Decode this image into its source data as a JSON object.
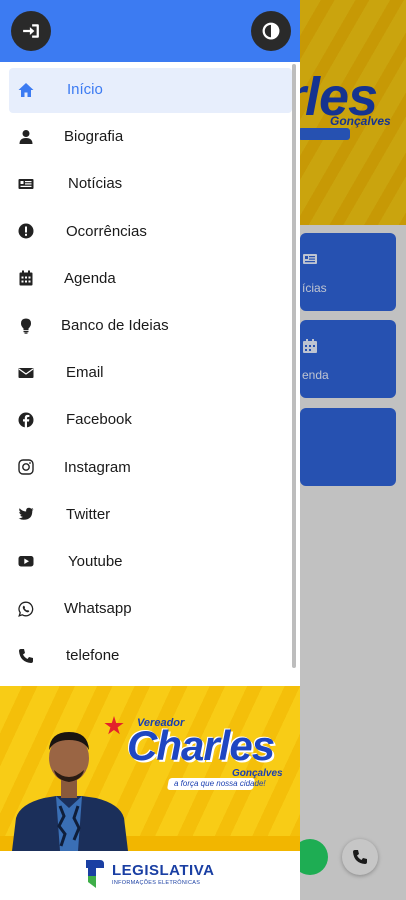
{
  "header": {
    "login_icon": "sign-in-icon",
    "theme_icon": "contrast-icon",
    "color": "#3c7bf2"
  },
  "menu": {
    "items": [
      {
        "label": "Início",
        "icon": "home-icon",
        "active": true
      },
      {
        "label": "Biografia",
        "icon": "user-icon"
      },
      {
        "label": "Notícias",
        "icon": "newspaper-icon"
      },
      {
        "label": "Ocorrências",
        "icon": "exclamation-icon"
      },
      {
        "label": "Agenda",
        "icon": "calendar-icon"
      },
      {
        "label": "Banco de Ideias",
        "icon": "lightbulb-icon"
      },
      {
        "label": "Email",
        "icon": "envelope-icon"
      },
      {
        "label": "Facebook",
        "icon": "facebook-icon"
      },
      {
        "label": "Instagram",
        "icon": "instagram-icon"
      },
      {
        "label": "Twitter",
        "icon": "twitter-icon"
      },
      {
        "label": "Youtube",
        "icon": "youtube-icon"
      },
      {
        "label": "Whatsapp",
        "icon": "whatsapp-icon"
      },
      {
        "label": "telefone",
        "icon": "phone-icon"
      }
    ]
  },
  "promo": {
    "pre_title": "Vereador",
    "title": "Charles",
    "subtitle": "Gonçalves",
    "slogan": "a força que nossa cidade!"
  },
  "footer_logo": {
    "name": "LEGISLATIVA",
    "tagline": "INFORMAÇÕES ELETRÔNICAS"
  },
  "background": {
    "banner_title": "rles",
    "banner_subtitle": "Gonçalves",
    "card1_label": "ícias",
    "card2_label": "enda",
    "accent": "#2f63d8",
    "banner_color": "#f7c812"
  }
}
